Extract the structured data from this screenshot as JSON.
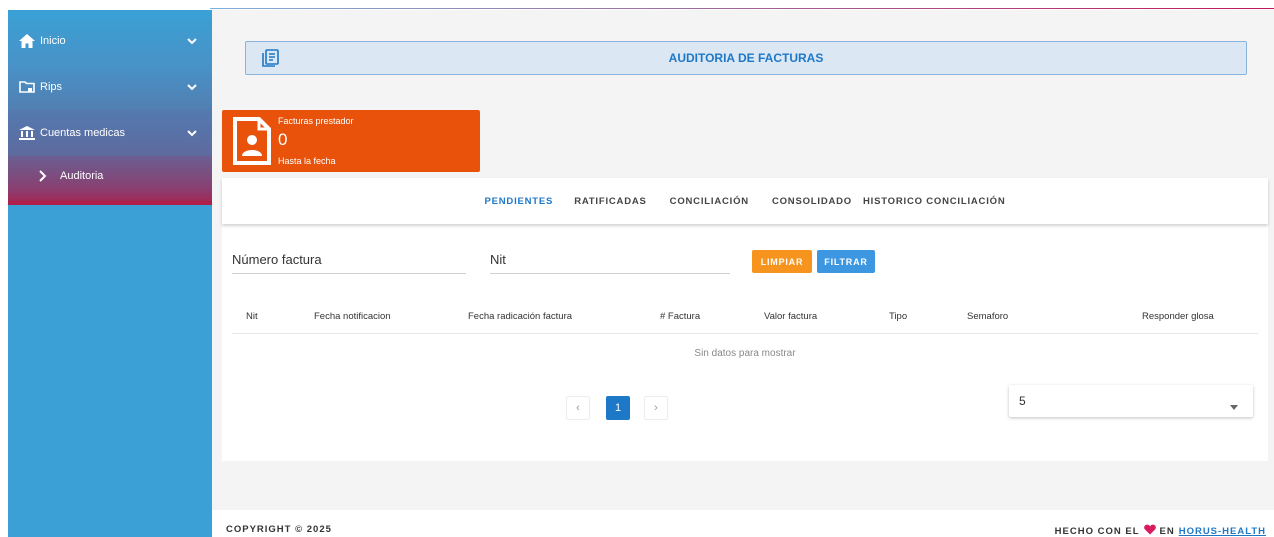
{
  "sidebar": {
    "items": [
      {
        "label": "Inicio",
        "icon": "home-icon"
      },
      {
        "label": "Rips",
        "icon": "folder-icon"
      },
      {
        "label": "Cuentas medicas",
        "icon": "bank-icon"
      }
    ],
    "subitem": {
      "label": "Auditoria",
      "icon": "chevron-right-icon"
    }
  },
  "header": {
    "title": "AUDITORIA DE FACTURAS",
    "icon": "document-icon"
  },
  "card": {
    "title": "Facturas prestador",
    "value": "0",
    "subtitle": "Hasta la fecha",
    "color": "#e8520b"
  },
  "tabs": [
    {
      "label": "PENDIENTES",
      "active": true
    },
    {
      "label": "RATIFICADAS",
      "active": false
    },
    {
      "label": "CONCILIACIÓN",
      "active": false
    },
    {
      "label": "CONSOLIDADO",
      "active": false
    },
    {
      "label": "HISTORICO CONCILIACIÓN",
      "active": false
    }
  ],
  "filters": {
    "numero_placeholder": "Número factura",
    "nit_placeholder": "Nit",
    "limpiar_label": "LIMPIAR",
    "filtrar_label": "FILTRAR"
  },
  "table": {
    "columns": [
      "Nit",
      "Fecha notificacion",
      "Fecha radicación factura",
      "# Factura",
      "Valor factura",
      "Tipo",
      "Semaforo",
      "Responder glosa"
    ],
    "empty_text": "Sin datos para mostrar"
  },
  "pagination": {
    "prev": "‹",
    "current": "1",
    "next": "›",
    "page_size": "5"
  },
  "footer": {
    "copyright": "COPYRIGHT © 2025",
    "made_with": "HECHO CON EL",
    "made_in": "EN",
    "link": "HORUS-HEALTH"
  },
  "colors": {
    "primary": "#1e78c8",
    "sidebar": "#3aa0d6",
    "accent": "#b01e4a",
    "orange": "#e8520b",
    "limpiar": "#f7941d",
    "filtrar": "#3d96e0",
    "heart": "#d81b60"
  }
}
